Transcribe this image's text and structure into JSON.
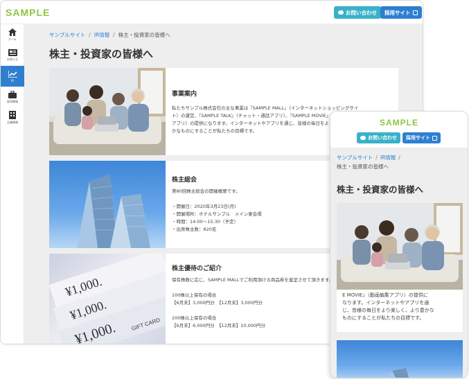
{
  "desktop": {
    "header": {
      "logo": "SAMPLE",
      "contact_label": "お問い合わせ",
      "recruit_label": "採用サイト"
    },
    "sidebar": {
      "items": [
        {
          "label": "ホーム",
          "icon": "home-icon"
        },
        {
          "label": "お知らせ",
          "icon": "news-icon"
        },
        {
          "label": "IR",
          "icon": "chart-icon",
          "active": true
        },
        {
          "label": "採用情報",
          "icon": "briefcase-icon"
        },
        {
          "label": "企業情報",
          "icon": "building-icon"
        }
      ]
    },
    "breadcrumb": {
      "home": "サンプルサイト",
      "ir": "IR情報",
      "current": "株主・投資家の皆様へ"
    },
    "page_title": "株主・投資家の皆様へ",
    "cards": [
      {
        "title": "事業案内",
        "text": "私たちサンプル株式会社の主な事業は『SAMPLE MALL』（インターネットショッピングサイ\nト）の運営、『SAMPLE TALK』（チャット・通話アプリ）、『SAMPLE MOVIE』（動画編集\nアプリ）の提供になります。インターネットやアプリを通じ、皆様の毎日をより楽しく、より豊\nかなものにすることが私たちの目標です。"
      },
      {
        "title": "株主総会",
        "text": "第80回株主総会の開催概要です。\n\n・開催日：2020年3月23日(月)\n・開催場所：ホテルサンプル　メイン宴会場\n・時間：14:00〜15:30（予定）\n・出席株主数：820名"
      },
      {
        "title": "株主優待のご紹介",
        "text": "保有株数に応じ、SAMPLE MALLでご利用頂ける商品券を進呈させて頂きます。\n\n100株以上保有の場合\n【6月末】3,000円分　【12月末】3,000円分\n\n200株以上保有の場合\n【6月末】6,000円分　【12月末】10,000円分"
      }
    ]
  },
  "mobile": {
    "header": {
      "logo": "SAMPLE",
      "contact_label": "お問い合わせ",
      "recruit_label": "採用サイト"
    },
    "breadcrumb": {
      "home": "サンプルサイト",
      "ir": "IR情報",
      "current": "株主・投資家の皆様へ"
    },
    "page_title": "株主・投資家の皆様へ",
    "card_text": "E MOVIE』（動画編集アプリ）の提供に\nなります。インターネットやアプリを通\nじ、皆様の毎日をより楽しく、より豊かな\nものにすることが私たちの目標です。"
  },
  "colors": {
    "brand_green": "#8cc63f",
    "contact_teal": "#38b2c8",
    "accent_blue": "#2e7fd0",
    "bg_gray": "#eeeeee"
  }
}
